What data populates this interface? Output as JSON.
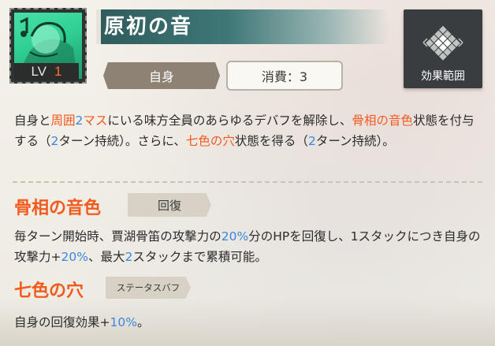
{
  "skill": {
    "name": "原初の音",
    "level_label": "LV",
    "level_value": "1",
    "icon": "green-character-portrait"
  },
  "pills": {
    "target": "自身",
    "cost": "消費：3"
  },
  "effect_range": {
    "label": "効果範囲",
    "icon": "diamond-grid-range-icon"
  },
  "description": [
    {
      "t": "自身と",
      "c": "n"
    },
    {
      "t": "周囲",
      "c": "o"
    },
    {
      "t": "2",
      "c": "b"
    },
    {
      "t": "マス",
      "c": "o"
    },
    {
      "t": "にいる味方全員のあらゆるデバフを解除し、",
      "c": "n"
    },
    {
      "t": "骨相の音色",
      "c": "o"
    },
    {
      "t": "状態を付与する（",
      "c": "n"
    },
    {
      "t": "2",
      "c": "b"
    },
    {
      "t": "ターン持続）。さらに、",
      "c": "n"
    },
    {
      "t": "七色の穴",
      "c": "o"
    },
    {
      "t": "状態を得る（",
      "c": "n"
    },
    {
      "t": "2",
      "c": "b"
    },
    {
      "t": "ターン持続）。",
      "c": "n"
    }
  ],
  "sections": [
    {
      "title": "骨相の音色",
      "tag": "回復",
      "body": [
        {
          "t": "毎ターン開始時、賈湖骨笛の攻撃力の",
          "c": "n"
        },
        {
          "t": "20%",
          "c": "b"
        },
        {
          "t": "分のHPを回復し、1スタックにつき自身の攻撃力+",
          "c": "n"
        },
        {
          "t": "20%",
          "c": "b"
        },
        {
          "t": "、最大",
          "c": "n"
        },
        {
          "t": "2",
          "c": "b"
        },
        {
          "t": "スタックまで累積可能。",
          "c": "n"
        }
      ]
    },
    {
      "title": "七色の穴",
      "tag": "ステータスバフ",
      "body": [
        {
          "t": "自身の回復効果+",
          "c": "n"
        },
        {
          "t": "10%",
          "c": "b"
        },
        {
          "t": "。",
          "c": "n"
        }
      ]
    }
  ],
  "colors": {
    "highlight_orange": "#f25a1e",
    "highlight_blue": "#3a86e0",
    "title_bar": "#3f7777"
  }
}
